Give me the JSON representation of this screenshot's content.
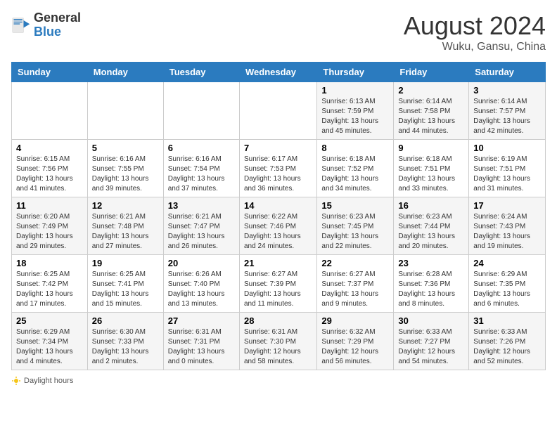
{
  "header": {
    "logo_text_general": "General",
    "logo_text_blue": "Blue",
    "month_year": "August 2024",
    "location": "Wuku, Gansu, China"
  },
  "weekdays": [
    "Sunday",
    "Monday",
    "Tuesday",
    "Wednesday",
    "Thursday",
    "Friday",
    "Saturday"
  ],
  "weeks": [
    [
      {
        "day": "",
        "info": ""
      },
      {
        "day": "",
        "info": ""
      },
      {
        "day": "",
        "info": ""
      },
      {
        "day": "",
        "info": ""
      },
      {
        "day": "1",
        "info": "Sunrise: 6:13 AM\nSunset: 7:59 PM\nDaylight: 13 hours and 45 minutes."
      },
      {
        "day": "2",
        "info": "Sunrise: 6:14 AM\nSunset: 7:58 PM\nDaylight: 13 hours and 44 minutes."
      },
      {
        "day": "3",
        "info": "Sunrise: 6:14 AM\nSunset: 7:57 PM\nDaylight: 13 hours and 42 minutes."
      }
    ],
    [
      {
        "day": "4",
        "info": "Sunrise: 6:15 AM\nSunset: 7:56 PM\nDaylight: 13 hours and 41 minutes."
      },
      {
        "day": "5",
        "info": "Sunrise: 6:16 AM\nSunset: 7:55 PM\nDaylight: 13 hours and 39 minutes."
      },
      {
        "day": "6",
        "info": "Sunrise: 6:16 AM\nSunset: 7:54 PM\nDaylight: 13 hours and 37 minutes."
      },
      {
        "day": "7",
        "info": "Sunrise: 6:17 AM\nSunset: 7:53 PM\nDaylight: 13 hours and 36 minutes."
      },
      {
        "day": "8",
        "info": "Sunrise: 6:18 AM\nSunset: 7:52 PM\nDaylight: 13 hours and 34 minutes."
      },
      {
        "day": "9",
        "info": "Sunrise: 6:18 AM\nSunset: 7:51 PM\nDaylight: 13 hours and 33 minutes."
      },
      {
        "day": "10",
        "info": "Sunrise: 6:19 AM\nSunset: 7:51 PM\nDaylight: 13 hours and 31 minutes."
      }
    ],
    [
      {
        "day": "11",
        "info": "Sunrise: 6:20 AM\nSunset: 7:49 PM\nDaylight: 13 hours and 29 minutes."
      },
      {
        "day": "12",
        "info": "Sunrise: 6:21 AM\nSunset: 7:48 PM\nDaylight: 13 hours and 27 minutes."
      },
      {
        "day": "13",
        "info": "Sunrise: 6:21 AM\nSunset: 7:47 PM\nDaylight: 13 hours and 26 minutes."
      },
      {
        "day": "14",
        "info": "Sunrise: 6:22 AM\nSunset: 7:46 PM\nDaylight: 13 hours and 24 minutes."
      },
      {
        "day": "15",
        "info": "Sunrise: 6:23 AM\nSunset: 7:45 PM\nDaylight: 13 hours and 22 minutes."
      },
      {
        "day": "16",
        "info": "Sunrise: 6:23 AM\nSunset: 7:44 PM\nDaylight: 13 hours and 20 minutes."
      },
      {
        "day": "17",
        "info": "Sunrise: 6:24 AM\nSunset: 7:43 PM\nDaylight: 13 hours and 19 minutes."
      }
    ],
    [
      {
        "day": "18",
        "info": "Sunrise: 6:25 AM\nSunset: 7:42 PM\nDaylight: 13 hours and 17 minutes."
      },
      {
        "day": "19",
        "info": "Sunrise: 6:25 AM\nSunset: 7:41 PM\nDaylight: 13 hours and 15 minutes."
      },
      {
        "day": "20",
        "info": "Sunrise: 6:26 AM\nSunset: 7:40 PM\nDaylight: 13 hours and 13 minutes."
      },
      {
        "day": "21",
        "info": "Sunrise: 6:27 AM\nSunset: 7:39 PM\nDaylight: 13 hours and 11 minutes."
      },
      {
        "day": "22",
        "info": "Sunrise: 6:27 AM\nSunset: 7:37 PM\nDaylight: 13 hours and 9 minutes."
      },
      {
        "day": "23",
        "info": "Sunrise: 6:28 AM\nSunset: 7:36 PM\nDaylight: 13 hours and 8 minutes."
      },
      {
        "day": "24",
        "info": "Sunrise: 6:29 AM\nSunset: 7:35 PM\nDaylight: 13 hours and 6 minutes."
      }
    ],
    [
      {
        "day": "25",
        "info": "Sunrise: 6:29 AM\nSunset: 7:34 PM\nDaylight: 13 hours and 4 minutes."
      },
      {
        "day": "26",
        "info": "Sunrise: 6:30 AM\nSunset: 7:33 PM\nDaylight: 13 hours and 2 minutes."
      },
      {
        "day": "27",
        "info": "Sunrise: 6:31 AM\nSunset: 7:31 PM\nDaylight: 13 hours and 0 minutes."
      },
      {
        "day": "28",
        "info": "Sunrise: 6:31 AM\nSunset: 7:30 PM\nDaylight: 12 hours and 58 minutes."
      },
      {
        "day": "29",
        "info": "Sunrise: 6:32 AM\nSunset: 7:29 PM\nDaylight: 12 hours and 56 minutes."
      },
      {
        "day": "30",
        "info": "Sunrise: 6:33 AM\nSunset: 7:27 PM\nDaylight: 12 hours and 54 minutes."
      },
      {
        "day": "31",
        "info": "Sunrise: 6:33 AM\nSunset: 7:26 PM\nDaylight: 12 hours and 52 minutes."
      }
    ]
  ],
  "footer": {
    "daylight_label": "Daylight hours"
  }
}
